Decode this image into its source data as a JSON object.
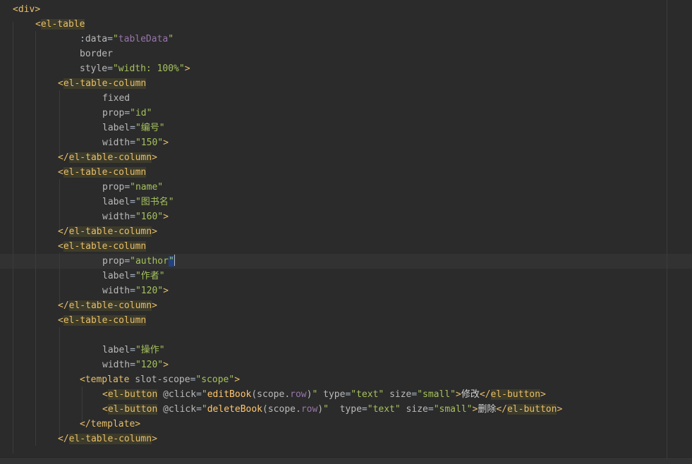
{
  "editor": {
    "lines": [
      {
        "tokens": [
          {
            "c": "br",
            "t": "<"
          },
          {
            "c": "tg",
            "t": "div"
          },
          {
            "c": "br",
            "t": ">"
          }
        ]
      },
      {
        "tokens": [
          {
            "c": "br",
            "t": "<"
          },
          {
            "c": "tg",
            "t": "el-table",
            "m": true
          }
        ]
      },
      {
        "tokens": [
          {
            "c": "eq",
            "t": ":"
          },
          {
            "c": "at",
            "t": "data"
          },
          {
            "c": "eq",
            "t": "="
          },
          {
            "c": "st",
            "t": "\""
          },
          {
            "c": "vr",
            "t": "tableData"
          },
          {
            "c": "st",
            "t": "\""
          }
        ]
      },
      {
        "tokens": [
          {
            "c": "at",
            "t": "border"
          }
        ]
      },
      {
        "tokens": [
          {
            "c": "at",
            "t": "style"
          },
          {
            "c": "eq",
            "t": "="
          },
          {
            "c": "st",
            "t": "\"width: 100%\""
          },
          {
            "c": "br",
            "t": ">"
          }
        ]
      },
      {
        "tokens": [
          {
            "c": "br",
            "t": "<"
          },
          {
            "c": "tg",
            "t": "el-table-column",
            "m": true
          }
        ]
      },
      {
        "tokens": [
          {
            "c": "at",
            "t": "fixed"
          }
        ]
      },
      {
        "tokens": [
          {
            "c": "at",
            "t": "prop"
          },
          {
            "c": "eq",
            "t": "="
          },
          {
            "c": "st",
            "t": "\"id\""
          }
        ]
      },
      {
        "tokens": [
          {
            "c": "at",
            "t": "label"
          },
          {
            "c": "eq",
            "t": "="
          },
          {
            "c": "st",
            "t": "\"编号\""
          }
        ]
      },
      {
        "tokens": [
          {
            "c": "at",
            "t": "width"
          },
          {
            "c": "eq",
            "t": "="
          },
          {
            "c": "st",
            "t": "\"150\""
          },
          {
            "c": "br",
            "t": ">"
          }
        ]
      },
      {
        "tokens": [
          {
            "c": "br",
            "t": "</"
          },
          {
            "c": "tg",
            "t": "el-table-column",
            "m": true
          },
          {
            "c": "br",
            "t": ">"
          }
        ]
      },
      {
        "tokens": [
          {
            "c": "br",
            "t": "<"
          },
          {
            "c": "tg",
            "t": "el-table-column",
            "m": true
          }
        ]
      },
      {
        "tokens": [
          {
            "c": "at",
            "t": "prop"
          },
          {
            "c": "eq",
            "t": "="
          },
          {
            "c": "st",
            "t": "\"name\""
          }
        ]
      },
      {
        "tokens": [
          {
            "c": "at",
            "t": "label"
          },
          {
            "c": "eq",
            "t": "="
          },
          {
            "c": "st",
            "t": "\"图书名\""
          }
        ]
      },
      {
        "tokens": [
          {
            "c": "at",
            "t": "width"
          },
          {
            "c": "eq",
            "t": "="
          },
          {
            "c": "st",
            "t": "\"160\""
          },
          {
            "c": "br",
            "t": ">"
          }
        ]
      },
      {
        "tokens": [
          {
            "c": "br",
            "t": "</"
          },
          {
            "c": "tg",
            "t": "el-table-column",
            "m": true
          },
          {
            "c": "br",
            "t": ">"
          }
        ]
      },
      {
        "tokens": [
          {
            "c": "br",
            "t": "<"
          },
          {
            "c": "tg",
            "t": "el-table-column",
            "m": true
          }
        ]
      },
      {
        "tokens": [
          {
            "c": "at",
            "t": "prop"
          },
          {
            "c": "eq",
            "t": "="
          },
          {
            "c": "st",
            "t": "\"author"
          },
          {
            "c": "st",
            "t": "\"",
            "cursor": true
          }
        ]
      },
      {
        "tokens": [
          {
            "c": "at",
            "t": "label"
          },
          {
            "c": "eq",
            "t": "="
          },
          {
            "c": "st",
            "t": "\"作者\""
          }
        ]
      },
      {
        "tokens": [
          {
            "c": "at",
            "t": "width"
          },
          {
            "c": "eq",
            "t": "="
          },
          {
            "c": "st",
            "t": "\"120\""
          },
          {
            "c": "br",
            "t": ">"
          }
        ]
      },
      {
        "tokens": [
          {
            "c": "br",
            "t": "</"
          },
          {
            "c": "tg",
            "t": "el-table-column",
            "m": true
          },
          {
            "c": "br",
            "t": ">"
          }
        ]
      },
      {
        "tokens": [
          {
            "c": "br",
            "t": "<"
          },
          {
            "c": "tg",
            "t": "el-table-column",
            "m": true
          }
        ]
      },
      {
        "tokens": []
      },
      {
        "tokens": [
          {
            "c": "at",
            "t": "label"
          },
          {
            "c": "eq",
            "t": "="
          },
          {
            "c": "st",
            "t": "\"操作\""
          }
        ]
      },
      {
        "tokens": [
          {
            "c": "at",
            "t": "width"
          },
          {
            "c": "eq",
            "t": "="
          },
          {
            "c": "st",
            "t": "\"120\""
          },
          {
            "c": "br",
            "t": ">"
          }
        ]
      },
      {
        "tokens": [
          {
            "c": "br",
            "t": "<"
          },
          {
            "c": "tg",
            "t": "template"
          },
          {
            "c": "pl",
            "t": " "
          },
          {
            "c": "at",
            "t": "slot-scope"
          },
          {
            "c": "eq",
            "t": "="
          },
          {
            "c": "st",
            "t": "\"scope\""
          },
          {
            "c": "br",
            "t": ">"
          }
        ]
      },
      {
        "tokens": [
          {
            "c": "br",
            "t": "<"
          },
          {
            "c": "tg",
            "t": "el-button",
            "m": true
          },
          {
            "c": "pl",
            "t": " "
          },
          {
            "c": "at",
            "t": "@click"
          },
          {
            "c": "eq",
            "t": "="
          },
          {
            "c": "st",
            "t": "\""
          },
          {
            "c": "fn",
            "t": "editBook"
          },
          {
            "c": "pl",
            "t": "(scope."
          },
          {
            "c": "vr",
            "t": "row"
          },
          {
            "c": "pl",
            "t": ")"
          },
          {
            "c": "st",
            "t": "\""
          },
          {
            "c": "pl",
            "t": " "
          },
          {
            "c": "at",
            "t": "type"
          },
          {
            "c": "eq",
            "t": "="
          },
          {
            "c": "st",
            "t": "\"text\""
          },
          {
            "c": "pl",
            "t": " "
          },
          {
            "c": "at",
            "t": "size"
          },
          {
            "c": "eq",
            "t": "="
          },
          {
            "c": "st",
            "t": "\"small\""
          },
          {
            "c": "br",
            "t": ">"
          },
          {
            "c": "tx",
            "t": "修改"
          },
          {
            "c": "br",
            "t": "</"
          },
          {
            "c": "tg",
            "t": "el-button",
            "m": true
          },
          {
            "c": "br",
            "t": ">"
          }
        ]
      },
      {
        "tokens": [
          {
            "c": "br",
            "t": "<"
          },
          {
            "c": "tg",
            "t": "el-button",
            "m": true
          },
          {
            "c": "pl",
            "t": " "
          },
          {
            "c": "at",
            "t": "@click"
          },
          {
            "c": "eq",
            "t": "="
          },
          {
            "c": "st",
            "t": "\""
          },
          {
            "c": "fn",
            "t": "deleteBook"
          },
          {
            "c": "pl",
            "t": "(scope."
          },
          {
            "c": "vr",
            "t": "row"
          },
          {
            "c": "pl",
            "t": ")"
          },
          {
            "c": "st",
            "t": "\""
          },
          {
            "c": "pl",
            "t": "  "
          },
          {
            "c": "at",
            "t": "type"
          },
          {
            "c": "eq",
            "t": "="
          },
          {
            "c": "st",
            "t": "\"text\""
          },
          {
            "c": "pl",
            "t": " "
          },
          {
            "c": "at",
            "t": "size"
          },
          {
            "c": "eq",
            "t": "="
          },
          {
            "c": "st",
            "t": "\"small\""
          },
          {
            "c": "br",
            "t": ">"
          },
          {
            "c": "tx",
            "t": "删除"
          },
          {
            "c": "br",
            "t": "</"
          },
          {
            "c": "tg",
            "t": "el-button",
            "m": true
          },
          {
            "c": "br",
            "t": ">"
          }
        ]
      },
      {
        "tokens": [
          {
            "c": "br",
            "t": "</"
          },
          {
            "c": "tg",
            "t": "template"
          },
          {
            "c": "br",
            "t": ">"
          }
        ]
      },
      {
        "tokens": [
          {
            "c": "br",
            "t": "</"
          },
          {
            "c": "tg",
            "t": "el-table-column",
            "m": true
          },
          {
            "c": "br",
            "t": ">"
          }
        ]
      }
    ]
  }
}
